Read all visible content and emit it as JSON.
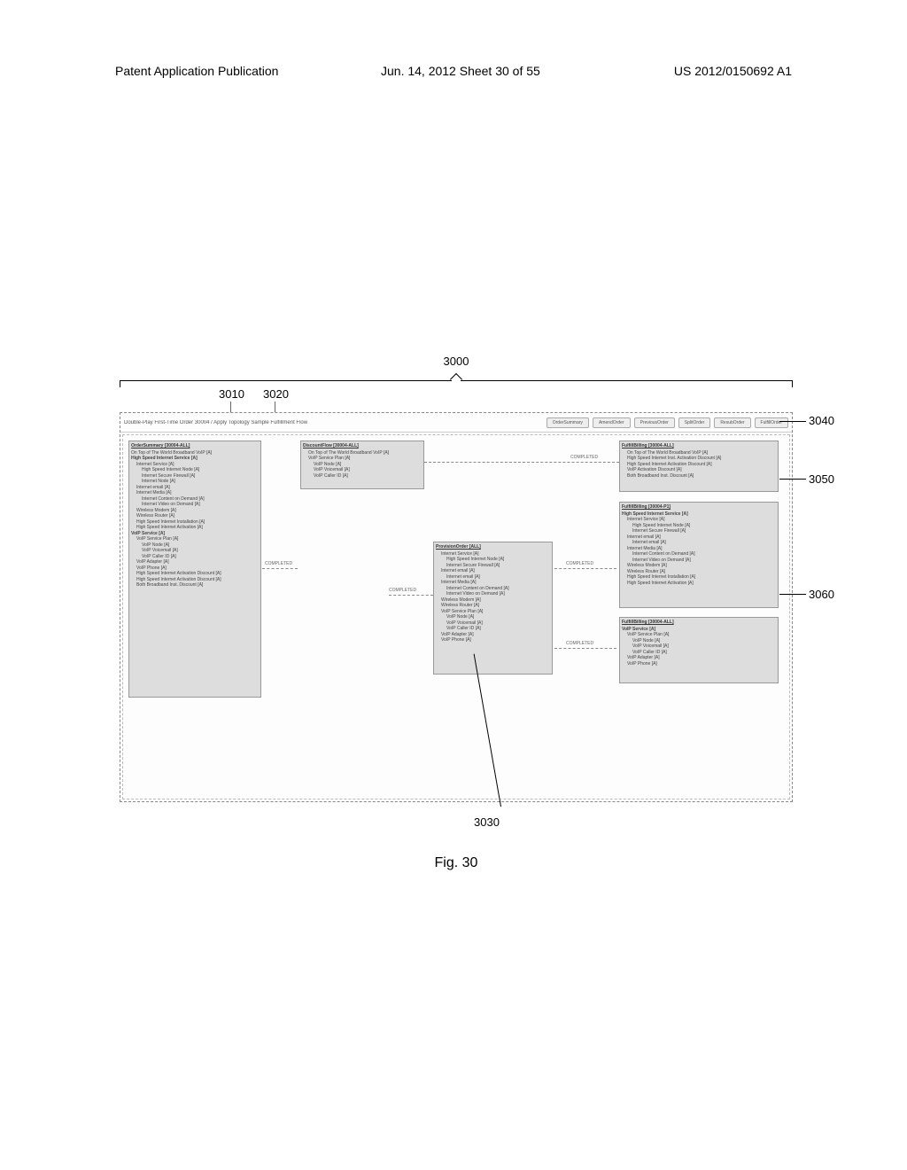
{
  "page_header": {
    "left": "Patent Application Publication",
    "center": "Jun. 14, 2012  Sheet 30 of 55",
    "right": "US 2012/0150692 A1"
  },
  "figure": {
    "number": "3000",
    "caption": "Fig. 30",
    "refs": {
      "r3010": "3010",
      "r3020": "3020",
      "r3030": "3030",
      "r3040": "3040",
      "r3050": "3050",
      "r3060": "3060"
    }
  },
  "titlebar": {
    "caption": "Double-Play First-Time Order 30004 / Apply Topology Sample Fulfillment Flow",
    "buttons": [
      "OrderSummary",
      "AmendOrder",
      "PreviousOrder",
      "SplitOrder",
      "ResubOrder",
      "FulfillOrder"
    ]
  },
  "panels": {
    "order_summary": {
      "title": "OrderSummary [30004-ALL]",
      "sub1": "On Top of The World Broadband VoIP [A]",
      "group1": "High Speed Internet Service [A]",
      "g1_items": [
        "Internet Service [A]",
        "High Speed Internet Node [A]",
        "Internet Secure Firewall [A]",
        "Internet Node [A]",
        "Internet email [A]",
        "Internet Media [A]",
        "Internet Content on Demand [A]",
        "Internet Video on Demand [A]",
        "Wireless Modem [A]",
        "Wireless Router [A]",
        "High Speed Internet Installation [A]",
        "High Speed Internet Activation [A]"
      ],
      "group2": "VoIP Service [A]",
      "g2_items": [
        "VoIP Service Plan [A]",
        "VoIP Node [A]",
        "VoIP Voicemail [A]",
        "VoIP Caller ID [A]",
        "VoIP Adapter [A]",
        "VoIP Phone [A]",
        "High Speed Internet Activation Discount [A]",
        "High Speed Internet Activation Discount [A]",
        "Both Broadband Inst. Discount [A]"
      ]
    },
    "discount_flow": {
      "title": "DiscountFlow [30004-ALL]",
      "items": [
        "On Top of The World Broadband VoIP [A]",
        "VoIP Service Plan [A]",
        "VoIP Node [A]",
        "VoIP Voicemail [A]",
        "VoIP Caller ID [A]"
      ]
    },
    "provision_order": {
      "title": "ProvisionOrder [ALL]",
      "items": [
        "Internet Service [A]",
        "High Speed Internet Node [A]",
        "Internet Secure Firewall [A]",
        "Internet email [A]",
        "Internet email [A]",
        "Internet Media [A]",
        "Internet Content on Demand [A]",
        "Internet Video on Demand [A]",
        "Wireless Modem [A]",
        "Wireless Router [A]",
        "",
        "VoIP Service Plan [A]",
        "VoIP Node [A]",
        "VoIP Voicemail [A]",
        "VoIP Caller ID [A]",
        "VoIP Adapter [A]",
        "VoIP Phone [A]"
      ]
    },
    "fulfill_billing_1": {
      "title": "FulfillBilling [30004-ALL]",
      "items": [
        "On Top of The World Broadband VoIP [A]",
        "High Speed Internet Inst. Activation Discount [A]",
        "High Speed Internet Activation Discount [A]",
        "VoIP Activation Discount [A]",
        "Both Broadband Inst. Discount [A]"
      ]
    },
    "fulfill_billing_2": {
      "title": "FulfillBilling [30004-P1]",
      "sub": "High Speed Internet Service [A]",
      "items": [
        "Internet Service [A]",
        "High Speed Internet Node [A]",
        "Internet Secure Firewall [A]",
        "Internet email [A]",
        "Internet email [A]",
        "Internet Media [A]",
        "Internet Content on Demand [A]",
        "Internet Video on Demand [A]",
        "Wireless Modem [A]",
        "Wireless Router [A]",
        "High Speed Internet Installation [A]",
        "High Speed Internet Activation [A]"
      ]
    },
    "fulfill_billing_3": {
      "title": "FulfillBilling [30004-ALL]",
      "sub": "VoIP Service [A]",
      "items": [
        "VoIP Service Plan [A]",
        "VoIP Node [A]",
        "VoIP Voicemail [A]",
        "VoIP Caller ID [A]",
        "VoIP Adapter [A]",
        "VoIP Phone [A]"
      ]
    }
  },
  "completed_label": "COMPLETED"
}
